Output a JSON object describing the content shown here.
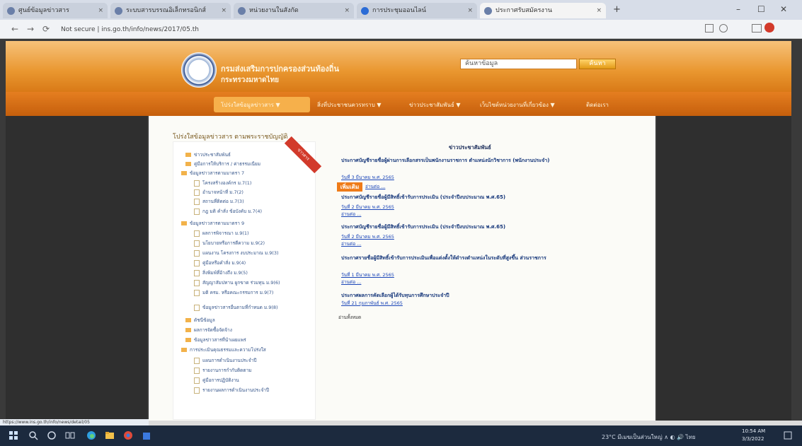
{
  "browser": {
    "tabs": [
      {
        "label": "ศูนย์ข้อมูลข่าวสาร"
      },
      {
        "label": "ระบบสารบรรณอิเล็กทรอนิกส์"
      },
      {
        "label": "หน่วยงานในสังกัด"
      },
      {
        "label": "การประชุมออนไลน์"
      },
      {
        "label": "ประกาศรับสมัครงาน"
      }
    ],
    "new_tab": "+",
    "url": "Not secure | ins.go.th/info/news/2017/05.th",
    "nav": {
      "back": "←",
      "forward": "→",
      "reload": "⟳"
    },
    "window": {
      "minimize": "–",
      "maximize": "☐",
      "close": "✕"
    }
  },
  "site": {
    "name_line1": "กรมส่งเสริมการปกครองส่วนท้องถิ่น",
    "name_line2": "กระทรวงมหาดไทย",
    "search_placeholder": "ค้นหาข้อมูล",
    "search_button": "ค้นหา"
  },
  "menu": [
    {
      "label": "โปร่งใสข้อมูลข่าวสาร ▼"
    },
    {
      "label": "สิ่งที่ประชาชนควรทราบ ▼"
    },
    {
      "label": "ข่าวประชาสัมพันธ์ ▼"
    },
    {
      "label": "เว็บไซต์หน่วยงานที่เกี่ยวข้อง ▼"
    },
    {
      "label": "ติดต่อเรา"
    }
  ],
  "sidebar": {
    "title": "โปร่งใสข้อมูลข่าวสาร ตามพระราชบัญญัติ",
    "ribbon": "ข่าวสาร",
    "items": [
      {
        "level": 1,
        "label": "ข่าวประชาสัมพันธ์"
      },
      {
        "level": 1,
        "label": "คู่มือการให้บริการ / ค่าธรรมเนียม"
      },
      {
        "level": 1,
        "label": "ข้อมูลข่าวสารตามมาตรา 7"
      },
      {
        "level": 2,
        "label": "โครงสร้างองค์กร ม.7(1)"
      },
      {
        "level": 2,
        "label": "อำนาจหน้าที่ ม.7(2)"
      },
      {
        "level": 2,
        "label": "สถานที่ติดต่อ ม.7(3)"
      },
      {
        "level": 2,
        "label": "กฎ มติ คำสั่ง ข้อบังคับ ม.7(4)"
      },
      {
        "level": 1,
        "label": "ข้อมูลข่าวสารตามมาตรา 9"
      },
      {
        "level": 2,
        "label": "ผลการพิจารณา ม.9(1)"
      },
      {
        "level": 2,
        "label": "นโยบายหรือการตีความ ม.9(2)"
      },
      {
        "level": 2,
        "label": "แผนงาน โครงการ งบประมาณ ม.9(3)"
      },
      {
        "level": 2,
        "label": "คู่มือหรือคำสั่ง ม.9(4)"
      },
      {
        "level": 2,
        "label": "สิ่งพิมพ์ที่อ้างถึง ม.9(5)"
      },
      {
        "level": 2,
        "label": "สัญญาสัมปทาน ผูกขาด ร่วมทุน ม.9(6)"
      },
      {
        "level": 2,
        "label": "มติ ครม. หรือคณะกรรมการ ม.9(7)"
      },
      {
        "level": 2,
        "label": "ข้อมูลข่าวสารอื่นตามที่กำหนด ม.9(8)"
      },
      {
        "level": 1,
        "label": "ดัชนีข้อมูล"
      },
      {
        "level": 1,
        "label": "ผลการจัดซื้อจัดจ้าง"
      },
      {
        "level": 1,
        "label": "ข้อมูลข่าวสารที่นำเผยแพร่"
      },
      {
        "level": 1,
        "label": "การประเมินคุณธรรมและความโปร่งใส"
      },
      {
        "level": 2,
        "label": "แผนการดำเนินงานประจำปี"
      },
      {
        "level": 2,
        "label": "รายงานการกำกับติดตาม"
      },
      {
        "level": 2,
        "label": "คู่มือการปฏิบัติงาน"
      },
      {
        "level": 2,
        "label": "รายงานผลการดำเนินงานประจำปี"
      }
    ]
  },
  "news": {
    "heading": "ข่าวประชาสัมพันธ์",
    "more_badge": "เพิ่มเติม",
    "items": [
      {
        "title": "ประกาศบัญชีรายชื่อผู้ผ่านการเลือกสรรเป็นพนักงานราชการ ตำแหน่งนักวิชาการ (พนักงานประจำ)",
        "date": "วันที่ 3 มีนาคม พ.ศ. 2565",
        "more": "อ่านต่อ ..."
      },
      {
        "title": "ประกาศบัญชีรายชื่อผู้มีสิทธิ์เข้ารับการประเมิน (ประจำปีงบประมาณ พ.ศ.65)",
        "date": "วันที่ 2 มีนาคม พ.ศ. 2565",
        "more": "อ่านต่อ ..."
      },
      {
        "title": "ประกาศบัญชีรายชื่อผู้มีสิทธิ์เข้ารับการประเมิน (ประจำปีงบประมาณ พ.ศ.65)",
        "date": "วันที่ 2 มีนาคม พ.ศ. 2565",
        "more": "อ่านต่อ ..."
      },
      {
        "title": "ประกาศรายชื่อผู้มีสิทธิ์เข้ารับการประเมินเพื่อแต่งตั้งให้ดำรงตำแหน่งในระดับที่สูงขึ้น ส่วนราชการ",
        "date": "วันที่ 1 มีนาคม พ.ศ. 2565",
        "more": "อ่านต่อ ..."
      },
      {
        "title": "ประกาศผลการคัดเลือกผู้ได้รับทุนการศึกษาประจำปี",
        "date": "วันที่ 21 กุมภาพันธ์ พ.ศ. 2565",
        "more": ""
      }
    ],
    "read_all": "อ่านทั้งหมด"
  },
  "status_url": "https://www.ins.go.th/info/news/detail/05",
  "taskbar": {
    "tray_text": "23°C  มีเมฆเป็นส่วนใหญ่  ∧  ◐  🔊  ไทย",
    "time": "10:54 AM",
    "date": "3/3/2022"
  },
  "colors": {
    "header_orange": "#e9962f",
    "menu_orange": "#d06a10",
    "link_blue": "#15367a",
    "badge_orange": "#ef7b18"
  }
}
